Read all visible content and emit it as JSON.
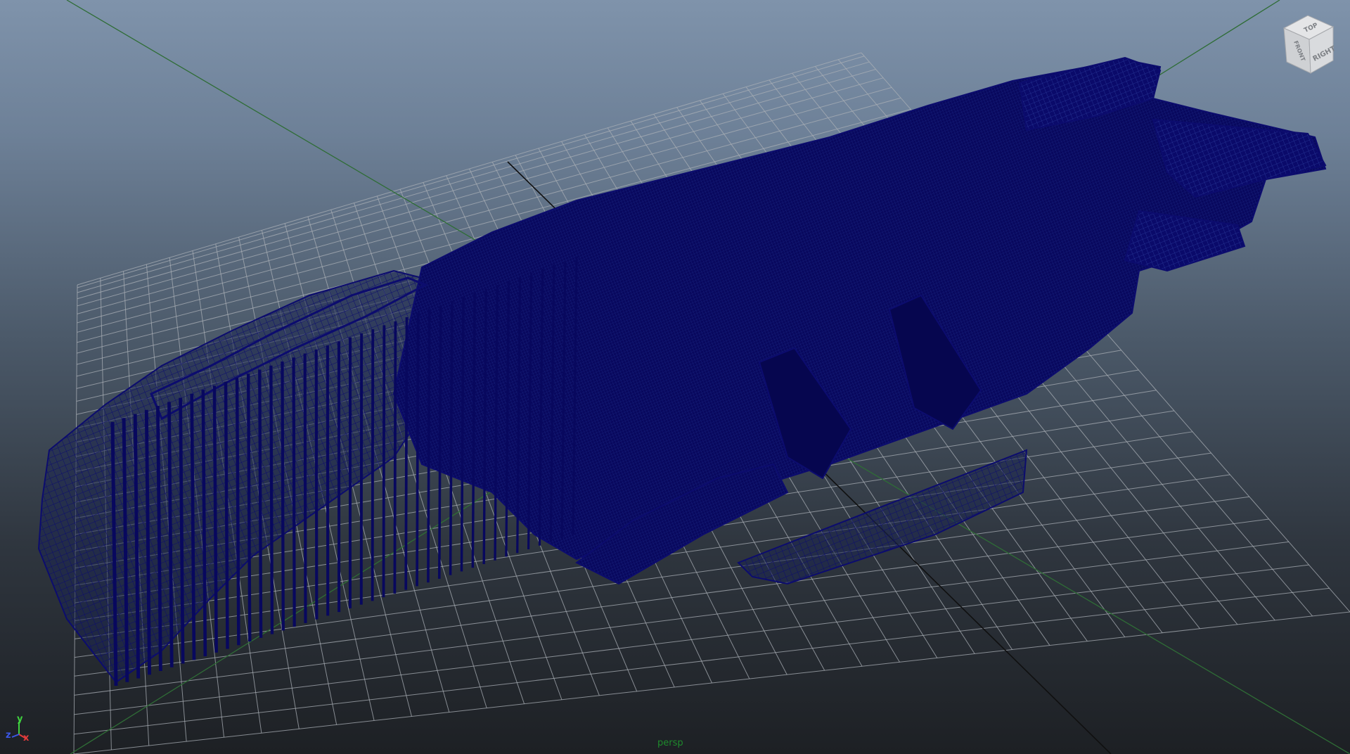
{
  "viewport": {
    "camera_name": "persp",
    "background_top_color": "#7f93ab",
    "background_bottom_color": "#1d2024",
    "grid_color": "#a9afb5",
    "wireframe_color": "#0c0c6e"
  },
  "view_cube": {
    "faces": {
      "top": "TOP",
      "right": "RIGHT",
      "front": "FRONT"
    }
  },
  "axis_gizmo": {
    "x": "x",
    "y": "y",
    "z": "z",
    "x_color": "#e23b3b",
    "y_color": "#3fd23f",
    "z_color": "#3b57e8"
  }
}
